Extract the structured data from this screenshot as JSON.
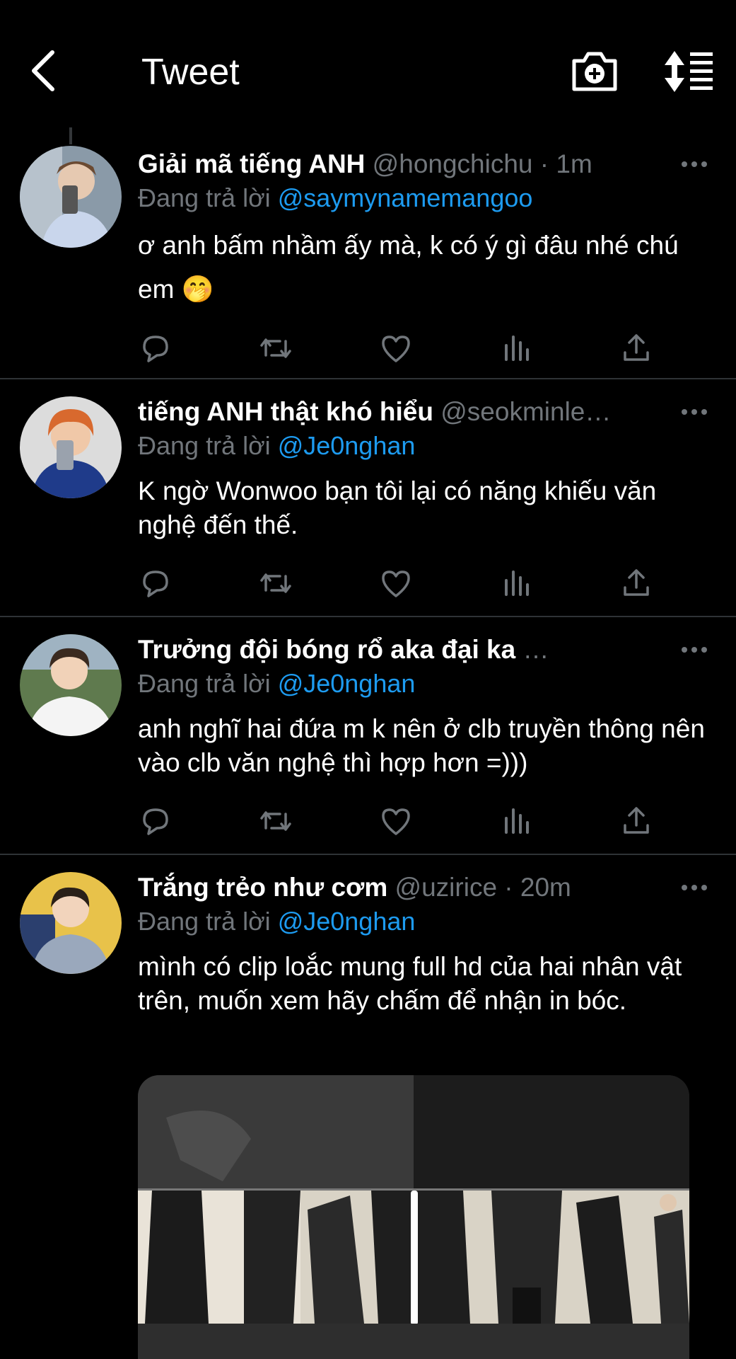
{
  "header": {
    "title": "Tweet"
  },
  "tweets": [
    {
      "name": "Giải mã tiếng ANH",
      "meta": " @hongchichu · 1m",
      "reply_prefix": "Đang trả lời ",
      "reply_to": "@saymynamemangoo",
      "text": "ơ anh bấm nhầm ấy mà, k có ý gì đâu nhé chú em 🤭"
    },
    {
      "name": "tiếng ANH thật khó hiểu",
      "meta": " @seokminle…",
      "reply_prefix": "Đang trả lời ",
      "reply_to": "@Je0nghan",
      "text": "K ngờ Wonwoo bạn tôi lại có năng khiếu văn nghệ đến thế."
    },
    {
      "name": "Trưởng đội bóng rổ aka đại ka",
      "meta": "  …",
      "reply_prefix": "Đang trả lời ",
      "reply_to": "@Je0nghan",
      "text": "anh nghĩ hai đứa m k nên ở clb truyền thông nên vào clb văn nghệ thì hợp hơn =)))"
    },
    {
      "name": "Trắng trẻo như cơm",
      "meta": " @uzirice · 20m",
      "reply_prefix": "Đang trả lời ",
      "reply_to": "@Je0nghan",
      "text": "mình có clip loắc mung full hd của hai nhân vật trên, muốn xem hãy chấm để nhận in bóc."
    }
  ],
  "colors": {
    "background": "#000000",
    "link": "#1d9bf0",
    "muted": "#71767b",
    "divider": "#2f3336"
  },
  "icons": [
    "back-icon",
    "camera-icon",
    "sort-icon",
    "more-icon",
    "reply-icon",
    "retweet-icon",
    "like-icon",
    "views-icon",
    "share-icon"
  ]
}
